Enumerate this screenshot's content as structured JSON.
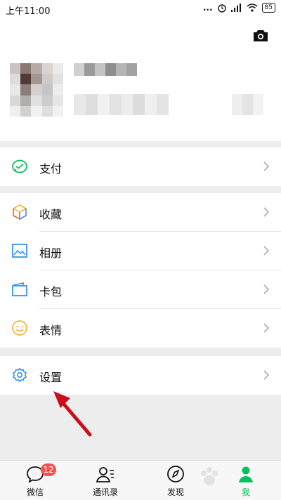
{
  "status_bar": {
    "time": "上午11:00",
    "dots": "...",
    "signal": "ıl",
    "battery": "85"
  },
  "profile": {
    "camera_icon": "camera-icon"
  },
  "menu": {
    "pay": "支付",
    "favorites": "收藏",
    "album": "相册",
    "card": "卡包",
    "stickers": "表情",
    "settings": "设置"
  },
  "tabbar": {
    "chats": {
      "label": "微信",
      "badge": "12"
    },
    "contacts": {
      "label": "通讯录"
    },
    "discover": {
      "label": "发现"
    },
    "me": {
      "label": "我"
    }
  },
  "colors": {
    "accent_green": "#07c160",
    "badge_red": "#f2534f",
    "annotation_red": "#c8101a"
  }
}
